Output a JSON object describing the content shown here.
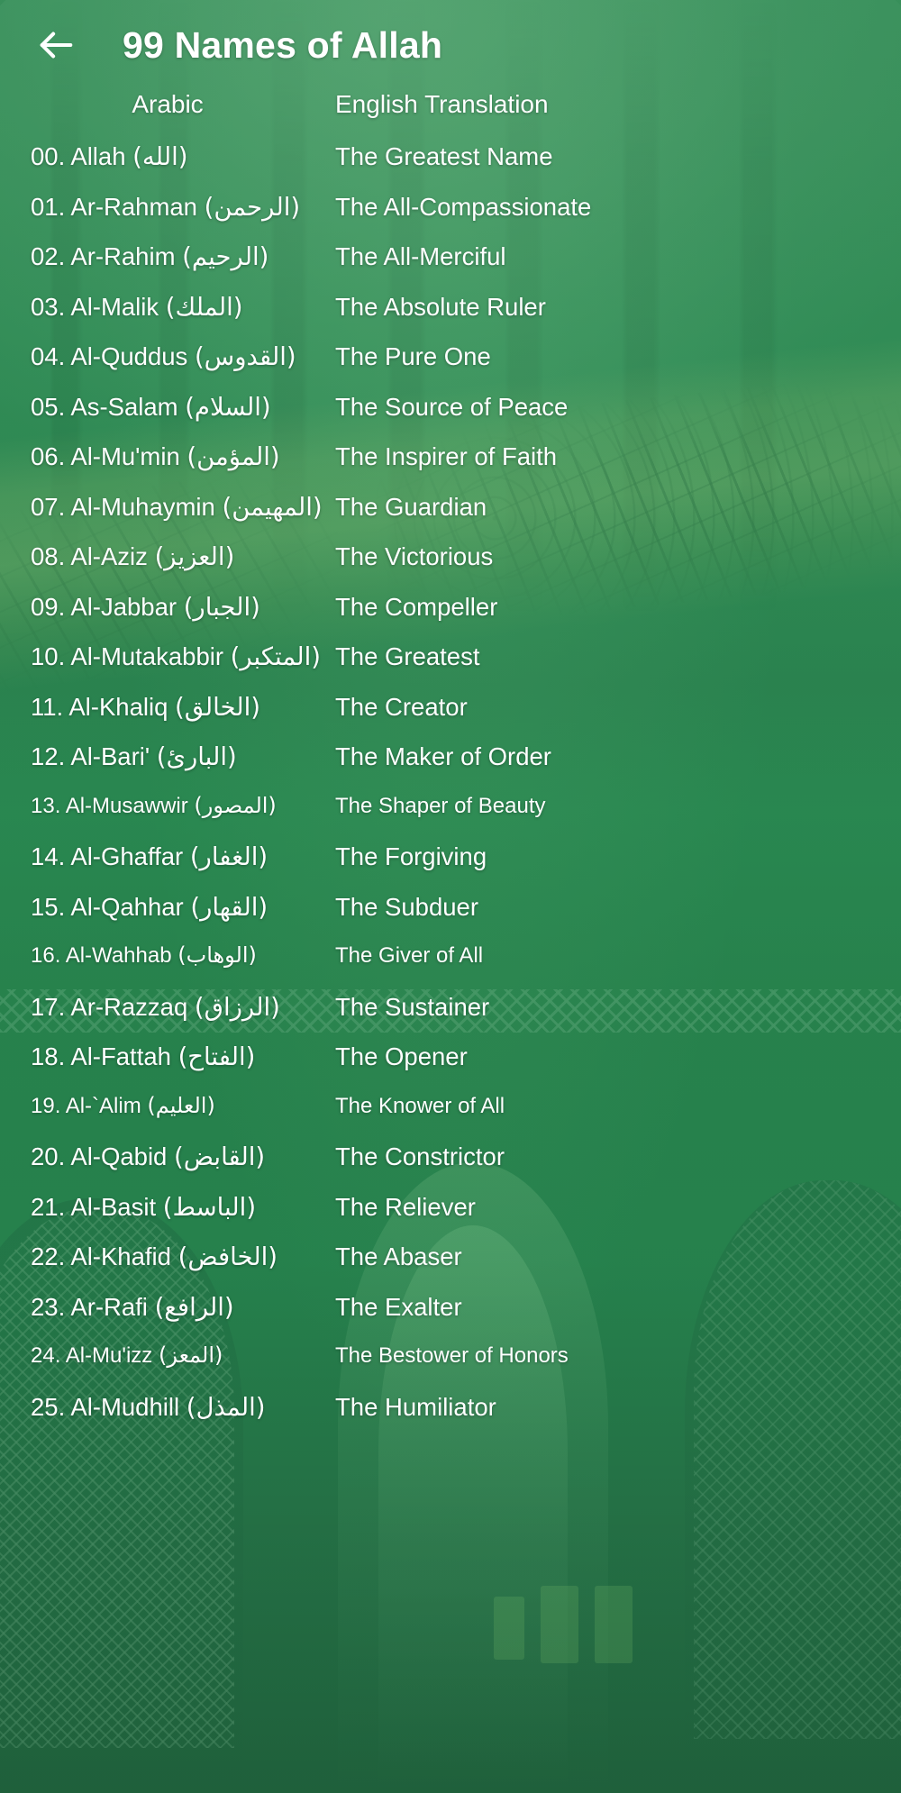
{
  "app": {
    "title": "99 Names of Allah",
    "back_icon": "back-arrow-icon",
    "accent_green": "#2e8b52",
    "text_color": "#ffffff"
  },
  "table": {
    "headers": {
      "arabic": "Arabic",
      "english": "English Translation"
    },
    "rows": [
      {
        "index": "00.",
        "name": "Allah",
        "arabic": "(الله)",
        "english": "The Greatest Name"
      },
      {
        "index": "01.",
        "name": "Ar-Rahman",
        "arabic": "(الرحمن)",
        "english": "The All-Compassionate"
      },
      {
        "index": "02.",
        "name": "Ar-Rahim",
        "arabic": "(الرحيم)",
        "english": "The All-Merciful"
      },
      {
        "index": "03.",
        "name": "Al-Malik",
        "arabic": "(الملك)",
        "english": "The Absolute Ruler"
      },
      {
        "index": "04.",
        "name": "Al-Quddus",
        "arabic": "(القدوس)",
        "english": "The Pure One"
      },
      {
        "index": "05.",
        "name": "As-Salam",
        "arabic": "(السلام)",
        "english": "The Source of Peace"
      },
      {
        "index": "06.",
        "name": "Al-Mu'min",
        "arabic": "(المؤمن)",
        "english": "The Inspirer of Faith"
      },
      {
        "index": "07.",
        "name": "Al-Muhaymin",
        "arabic": "(المهيمن)",
        "english": "The Guardian"
      },
      {
        "index": "08.",
        "name": "Al-Aziz",
        "arabic": "(العزيز)",
        "english": "The Victorious"
      },
      {
        "index": "09.",
        "name": "Al-Jabbar",
        "arabic": "(الجبار)",
        "english": "The Compeller"
      },
      {
        "index": "10.",
        "name": "Al-Mutakabbir",
        "arabic": "(المتكبر)",
        "english": "The Greatest"
      },
      {
        "index": "11.",
        "name": "Al-Khaliq",
        "arabic": "(الخالق)",
        "english": "The Creator"
      },
      {
        "index": "12.",
        "name": "Al-Bari'",
        "arabic": "(البارئ)",
        "english": "The Maker of Order"
      },
      {
        "index": "13.",
        "name": "Al-Musawwir",
        "arabic": "(المصور)",
        "english": "The Shaper of Beauty"
      },
      {
        "index": "14.",
        "name": "Al-Ghaffar",
        "arabic": "(الغفار)",
        "english": "The Forgiving"
      },
      {
        "index": "15.",
        "name": "Al-Qahhar",
        "arabic": "(القهار)",
        "english": "The Subduer"
      },
      {
        "index": "16.",
        "name": "Al-Wahhab",
        "arabic": "(الوهاب)",
        "english": "The Giver of All"
      },
      {
        "index": "17.",
        "name": "Ar-Razzaq",
        "arabic": "(الرزاق)",
        "english": "The Sustainer"
      },
      {
        "index": "18.",
        "name": "Al-Fattah",
        "arabic": "(الفتاح)",
        "english": "The Opener"
      },
      {
        "index": "19.",
        "name": "Al-`Alim",
        "arabic": "(العليم)",
        "english": "The Knower of All"
      },
      {
        "index": "20.",
        "name": "Al-Qabid",
        "arabic": "(القابض)",
        "english": "The Constrictor"
      },
      {
        "index": "21.",
        "name": "Al-Basit",
        "arabic": "(الباسط)",
        "english": "The Reliever"
      },
      {
        "index": "22.",
        "name": "Al-Khafid",
        "arabic": "(الخافض)",
        "english": "The Abaser"
      },
      {
        "index": "23.",
        "name": "Ar-Rafi",
        "arabic": "(الرافع)",
        "english": "The Exalter"
      },
      {
        "index": "24.",
        "name": "Al-Mu'izz",
        "arabic": "(المعز)",
        "english": "The Bestower of Honors"
      },
      {
        "index": "25.",
        "name": "Al-Mudhill",
        "arabic": "(المذل)",
        "english": "The Humiliator"
      }
    ]
  }
}
